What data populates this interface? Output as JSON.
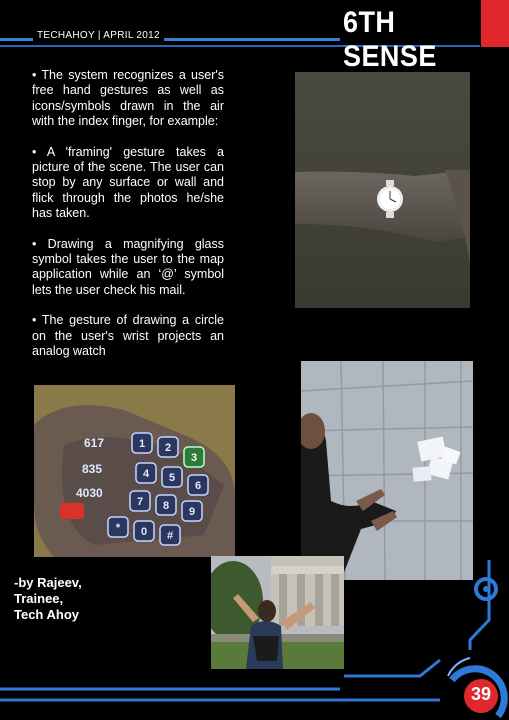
{
  "header": {
    "tag": "TECHAHOY | APRIL 2012",
    "section_title": "6TH SENSE"
  },
  "body": {
    "paragraphs": [
      "• The system recognizes a user's free hand gestures as well as icons/symbols drawn in the air with the index finger, for example:",
      "• A 'framing' gesture takes a picture of the scene. The user can stop by any surface or wall and flick through the photos he/she has taken.",
      "• Drawing a magnifying glass symbol takes the user to the map application while an ‘@’ symbol lets the user check his mail.",
      "• The gesture of drawing a circle on the user's wrist projects an analog watch"
    ]
  },
  "keypad_photo": {
    "numbers": [
      "617",
      "835",
      "4030"
    ],
    "keys": [
      "1",
      "2",
      "3",
      "4",
      "5",
      "6",
      "7",
      "8",
      "9",
      "*",
      "0",
      "#"
    ]
  },
  "byline": {
    "lines": [
      "-by Rajeev,",
      "Trainee,",
      "Tech Ahoy"
    ]
  },
  "page_number": "39",
  "colors": {
    "accent_blue": "#3b7fd4",
    "accent_red": "#e0282c",
    "background": "#000000"
  }
}
